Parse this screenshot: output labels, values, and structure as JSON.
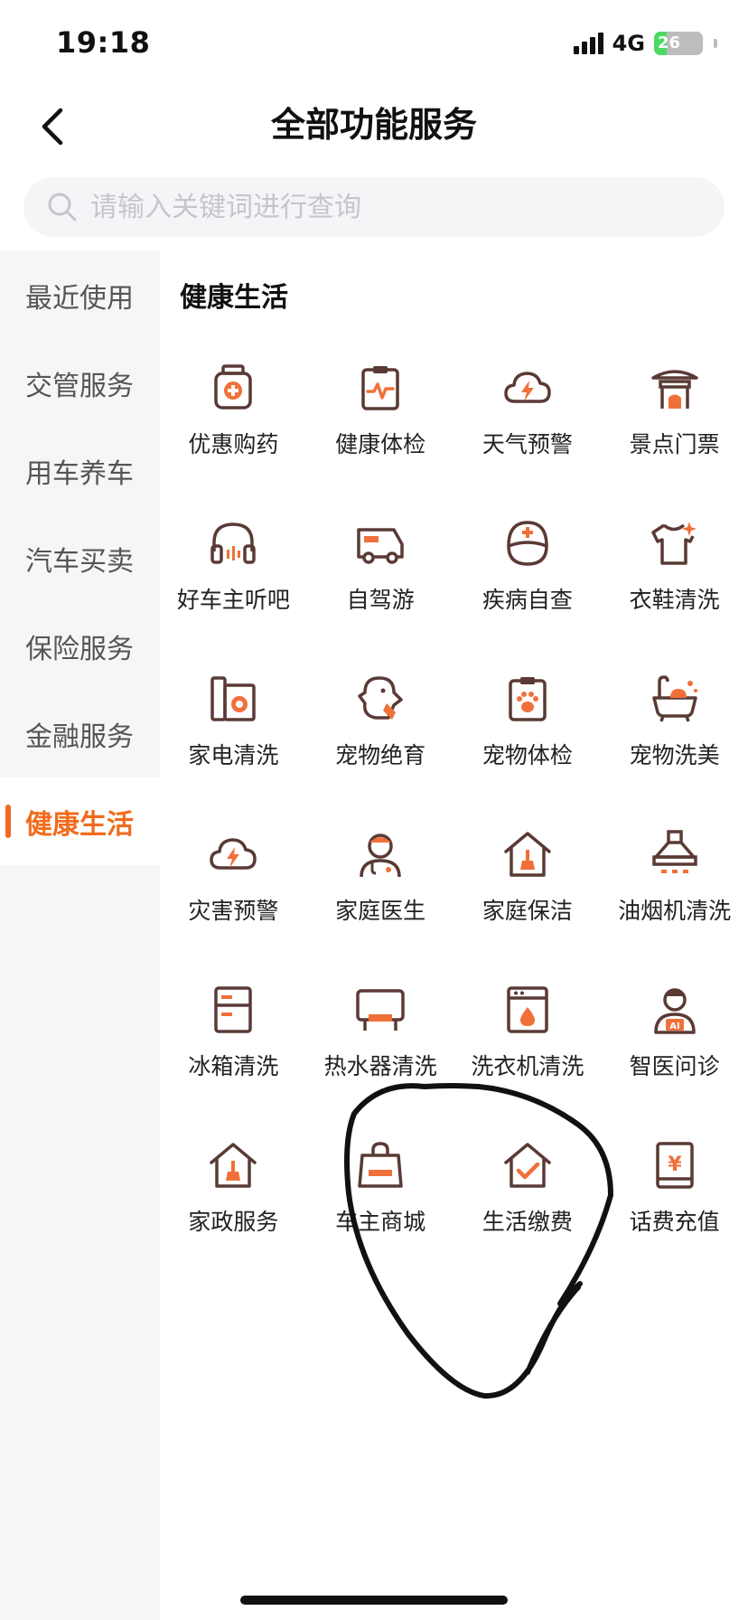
{
  "status_bar": {
    "time": "19:18",
    "network": "4G",
    "battery": "26"
  },
  "header": {
    "title": "全部功能服务"
  },
  "search": {
    "placeholder": "请输入关键词进行查询"
  },
  "sidebar": {
    "items": [
      {
        "label": "最近使用",
        "active": false
      },
      {
        "label": "交管服务",
        "active": false
      },
      {
        "label": "用车养车",
        "active": false
      },
      {
        "label": "汽车买卖",
        "active": false
      },
      {
        "label": "保险服务",
        "active": false
      },
      {
        "label": "金融服务",
        "active": false
      },
      {
        "label": "健康生活",
        "active": true
      }
    ]
  },
  "section": {
    "title": "健康生活",
    "items": [
      {
        "label": "优惠购药",
        "icon": "medicine-bottle-icon"
      },
      {
        "label": "健康体检",
        "icon": "health-check-clipboard-icon"
      },
      {
        "label": "天气预警",
        "icon": "weather-alert-cloud-icon"
      },
      {
        "label": "景点门票",
        "icon": "scenic-pavilion-icon"
      },
      {
        "label": "好车主听吧",
        "icon": "headphones-icon"
      },
      {
        "label": "自驾游",
        "icon": "camper-van-icon"
      },
      {
        "label": "疾病自查",
        "icon": "nurse-cap-icon"
      },
      {
        "label": "衣鞋清洗",
        "icon": "tshirt-sparkle-icon"
      },
      {
        "label": "家电清洗",
        "icon": "appliance-icon"
      },
      {
        "label": "宠物绝育",
        "icon": "pet-dog-icon"
      },
      {
        "label": "宠物体检",
        "icon": "pet-paw-clipboard-icon"
      },
      {
        "label": "宠物洗美",
        "icon": "pet-bathtub-icon"
      },
      {
        "label": "灾害预警",
        "icon": "disaster-alert-cloud-icon"
      },
      {
        "label": "家庭医生",
        "icon": "family-doctor-icon"
      },
      {
        "label": "家庭保洁",
        "icon": "house-cleaning-icon"
      },
      {
        "label": "油烟机清洗",
        "icon": "range-hood-icon"
      },
      {
        "label": "冰箱清洗",
        "icon": "fridge-icon"
      },
      {
        "label": "热水器清洗",
        "icon": "water-heater-icon"
      },
      {
        "label": "洗衣机清洗",
        "icon": "washing-machine-icon"
      },
      {
        "label": "智医问诊",
        "icon": "ai-doctor-icon"
      },
      {
        "label": "家政服务",
        "icon": "housekeeping-icon"
      },
      {
        "label": "车主商城",
        "icon": "shopping-bag-icon"
      },
      {
        "label": "生活缴费",
        "icon": "house-check-icon"
      },
      {
        "label": "话费充值",
        "icon": "phone-recharge-yen-icon"
      }
    ]
  },
  "colors": {
    "accent": "#f26b1d",
    "icon_stroke": "#5a3a35",
    "icon_accent": "#f0703a"
  }
}
